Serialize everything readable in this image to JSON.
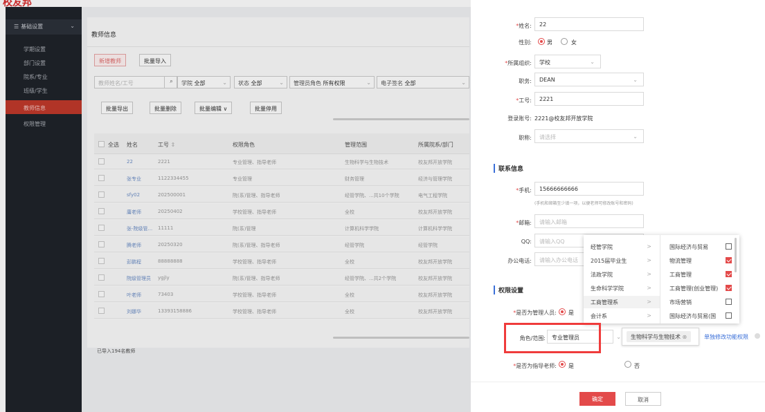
{
  "app": {
    "logo": "校友邦"
  },
  "sidebar": {
    "header": "基础设置",
    "header_icon": "menu-icon",
    "items": [
      {
        "label": "学期设置"
      },
      {
        "label": "部门设置"
      },
      {
        "label": "院系/专业"
      },
      {
        "label": "班级/学生"
      },
      {
        "label": "教师信息",
        "active": true
      },
      {
        "label": "权限管理"
      }
    ]
  },
  "main": {
    "title": "教师信息",
    "buttons": {
      "add": "新增教师",
      "batch_import": "批量导入"
    },
    "search": {
      "placeholder": "教师姓名/工号"
    },
    "filters": [
      {
        "label": "学院",
        "value": "全部"
      },
      {
        "label": "状态",
        "value": "全部"
      },
      {
        "label": "管理员角色",
        "value": "所有权限"
      },
      {
        "label": "电子签名",
        "value": "全部"
      }
    ],
    "batch": {
      "export": "批量导出",
      "delete": "批量删除",
      "edit": "批量编辑 ∨",
      "disable": "批量停用"
    },
    "table": {
      "headers": {
        "select_all": "全选",
        "name": "姓名",
        "id": "工号",
        "role": "权限角色",
        "scope": "管理范围",
        "dept": "所属院系/部门"
      },
      "rows": [
        {
          "name": "22",
          "id": "2221",
          "role": "专业管理、指导老师",
          "scope": "生物科学与生物技术",
          "dept": "校友邦开放学院"
        },
        {
          "name": "张专业",
          "id": "1122334455",
          "role": "专业管理",
          "scope": "财务管理",
          "dept": "经济与管理学院"
        },
        {
          "name": "sfy02",
          "id": "202500001",
          "role": "院(系)管理、指导老师",
          "scope": "经管学院、...共10个学院",
          "dept": "电气工程学院"
        },
        {
          "name": "庸老师",
          "id": "20250402",
          "role": "学校管理、指导老师",
          "scope": "全校",
          "dept": "校友邦开放学院"
        },
        {
          "name": "张-院级管...",
          "id": "11111",
          "role": "院(系)管理",
          "scope": "计算机科学学院",
          "dept": "计算机科学学院"
        },
        {
          "name": "腾老师",
          "id": "20250320",
          "role": "院(系)管理、指导老师",
          "scope": "经管学院",
          "dept": "经管学院"
        },
        {
          "name": "彭鹏程",
          "id": "88888888",
          "role": "学校管理、指导老师",
          "scope": "全校",
          "dept": "校友邦开放学院"
        },
        {
          "name": "院级管理员",
          "id": "ygjly",
          "role": "院(系)管理、指导老师",
          "scope": "经管学院、...共2个学院",
          "dept": "校友邦开放学院"
        },
        {
          "name": "叶老师",
          "id": "73403",
          "role": "学校管理、指导老师",
          "scope": "全校",
          "dept": "校友邦开放学院"
        },
        {
          "name": "刘娜华",
          "id": "13393158886",
          "role": "学校管理、指导老师",
          "scope": "全校",
          "dept": "校友邦开放学院"
        }
      ],
      "footer": "已导入194名教师"
    }
  },
  "drawer": {
    "name": {
      "label": "姓名:",
      "value": "22"
    },
    "gender": {
      "label": "性别:",
      "male": "男",
      "female": "女",
      "selected": "男"
    },
    "org": {
      "label": "所属组织:",
      "value": "学校"
    },
    "position": {
      "label": "职务:",
      "value": "DEAN"
    },
    "staff_id": {
      "label": "工号:",
      "value": "2221"
    },
    "login": {
      "label": "登录账号:",
      "value": "2221@校友邦开放学院"
    },
    "title": {
      "label": "职称:",
      "placeholder": "请选择"
    },
    "contact_section": "联系信息",
    "phone": {
      "label": "手机:",
      "value": "15666666666",
      "hint": "(手机和邮箱至少填一项，以便老师可修改账号和密码)"
    },
    "email": {
      "label": "邮箱:",
      "placeholder": "请输入邮箱"
    },
    "qq": {
      "label": "QQ:",
      "placeholder": "请输入QQ"
    },
    "office": {
      "label": "办公电话:",
      "placeholder": "请输入办公电话"
    },
    "perm_section": "权限设置",
    "is_admin": {
      "label": "是否为管理人员:",
      "yes": "是"
    },
    "role": {
      "label": "角色/范围:",
      "value": "专业管理员"
    },
    "scope_tag": "生物科学与生物技术",
    "edit_perm_link": "单独修改功能权限",
    "is_advisor": {
      "label": "是否为指导老师:",
      "yes": "是",
      "no": "否"
    },
    "confirm": "确定",
    "cancel": "取消"
  },
  "cascader": {
    "level1": [
      "经管学院",
      "2015届毕业生",
      "法政学院",
      "生命科学学院",
      "工商管理系",
      "会计系"
    ],
    "level1_selected": "工商管理系",
    "level2": [
      {
        "label": "国际经济与贸易",
        "checked": false
      },
      {
        "label": "物流管理",
        "checked": true
      },
      {
        "label": "工商管理",
        "checked": true
      },
      {
        "label": "工商管理(创业管理)",
        "checked": true
      },
      {
        "label": "市场营销",
        "checked": false
      },
      {
        "label": "国际经济与贸易(国",
        "checked": false
      }
    ]
  },
  "colors": {
    "accent": "#e34a4a",
    "sidebar_bg": "#1f232a",
    "highlight": "#ef3b3b"
  }
}
